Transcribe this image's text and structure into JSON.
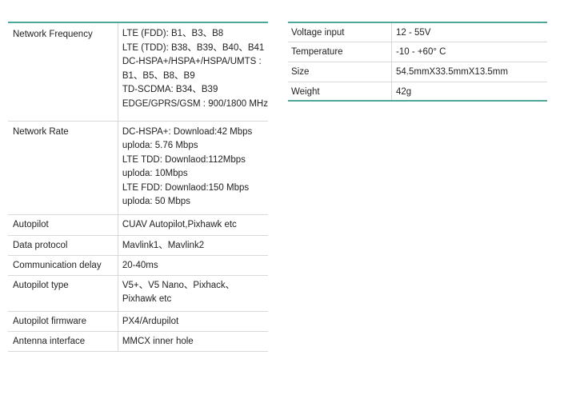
{
  "left_table": {
    "rows": [
      {
        "label": "Network Frequency",
        "lines": [
          "LTE (FDD): B1、B3、B8",
          "LTE (TDD): B38、B39、B40、B41",
          "DC-HSPA+/HSPA+/HSPA/UMTS :",
          "B1、B5、B8、B9",
          "TD-SCDMA: B34、B39",
          "EDGE/GPRS/GSM : 900/1800 MHz"
        ]
      },
      {
        "label": "Network Rate",
        "lines": [
          "DC-HSPA+: Download:42 Mbps",
          "uploda: 5.76 Mbps",
          "LTE TDD: Downlaod:112Mbps",
          "uploda: 10Mbps",
          "LTE FDD: Downlaod:150 Mbps",
          "uploda: 50 Mbps"
        ]
      },
      {
        "label": "Autopilot",
        "lines": [
          "CUAV Autopilot,Pixhawk etc"
        ]
      },
      {
        "label": "Data protocol",
        "lines": [
          "Mavlink1、Mavlink2"
        ]
      },
      {
        "label": "Communication delay",
        "lines": [
          "20-40ms"
        ]
      },
      {
        "label": "Autopilot type",
        "lines": [
          "V5+、V5 Nano、Pixhack、",
          "Pixhawk etc"
        ]
      },
      {
        "label": "Autopilot firmware",
        "lines": [
          "PX4/Ardupilot"
        ]
      },
      {
        "label": "Antenna interface",
        "lines": [
          "MMCX inner hole"
        ]
      }
    ]
  },
  "right_table": {
    "rows": [
      {
        "label": "Voltage input",
        "value": "12 - 55V"
      },
      {
        "label": "Temperature",
        "value": "-10 - +60° C"
      },
      {
        "label": "Size",
        "value": "54.5mmX33.5mmX13.5mm"
      },
      {
        "label": "Weight",
        "value": "42g"
      }
    ]
  },
  "colors": {
    "accent": "#4fa79b",
    "divider": "#d9d9d9",
    "text": "#222222"
  }
}
